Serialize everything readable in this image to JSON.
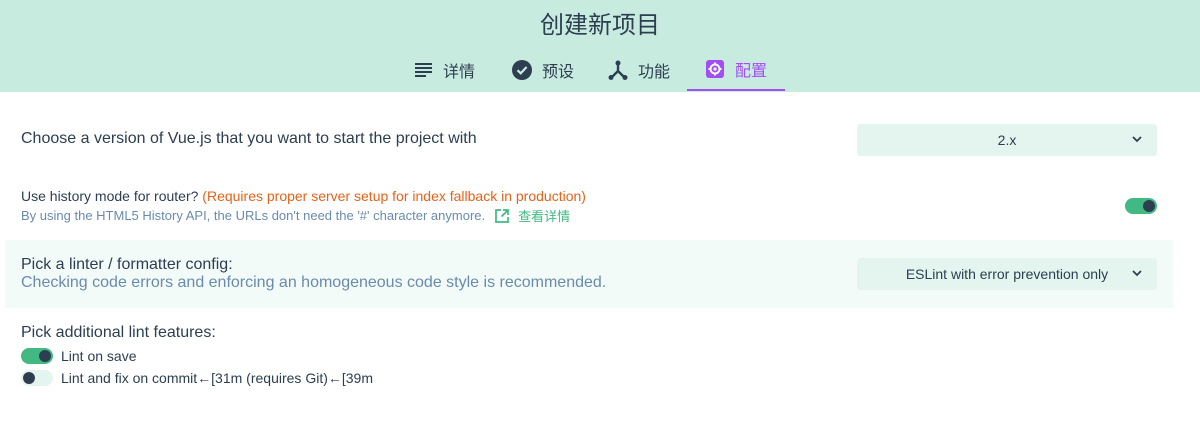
{
  "header": {
    "title": "创建新项目",
    "tabs": [
      {
        "label": "详情",
        "icon": "list-icon"
      },
      {
        "label": "预设",
        "icon": "check-circle-icon"
      },
      {
        "label": "功能",
        "icon": "fork-icon"
      },
      {
        "label": "配置",
        "icon": "gear-icon",
        "active": true
      }
    ]
  },
  "prompts": {
    "vue_version": {
      "label": "Choose a version of Vue.js that you want to start the project with",
      "value": "2.x"
    },
    "history_mode": {
      "label": "Use history mode for router?",
      "warning": "(Requires proper server setup for index fallback in production)",
      "description": "By using the HTML5 History API, the URLs don't need the '#' character anymore.",
      "link_label": "查看详情",
      "enabled": true
    },
    "linter": {
      "label": "Pick a linter / formatter config:",
      "description": "Checking code errors and enforcing an homogeneous code style is recommended.",
      "value": "ESLint with error prevention only"
    },
    "lint_features": {
      "label": "Pick additional lint features:",
      "options": [
        {
          "label": "Lint on save",
          "enabled": true
        },
        {
          "label": "Lint and fix on commit←[31m (requires Git)←[39m",
          "enabled": false
        }
      ]
    }
  },
  "colors": {
    "header_bg": "#c8ebdf",
    "accent": "#42b983",
    "active_tab": "#a44cf6",
    "warning": "#e5631a"
  }
}
